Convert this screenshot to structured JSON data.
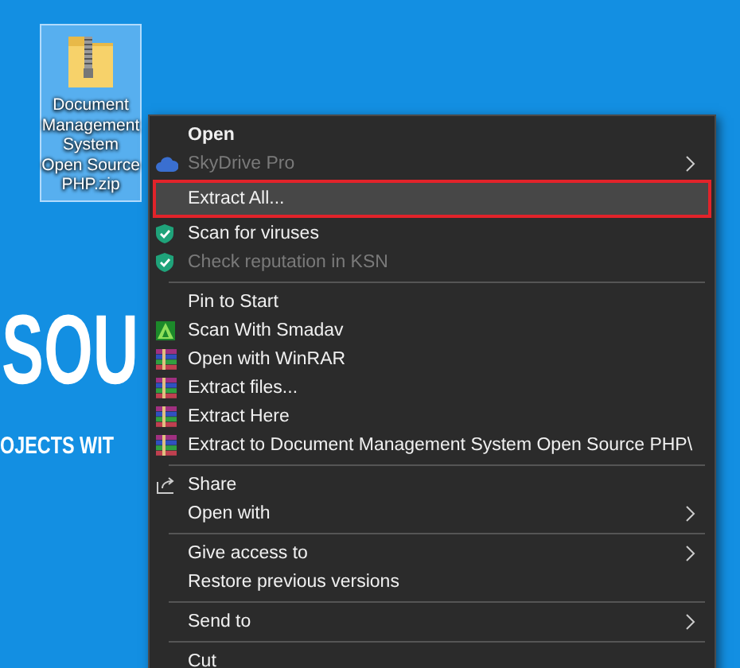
{
  "desktop": {
    "background_text": [
      "SOU",
      "OJECTS WIT"
    ],
    "file_icon": {
      "label": "Document Management System Open Source PHP.zip",
      "selected": true
    }
  },
  "context_menu": {
    "groups": [
      {
        "items": [
          {
            "label": "Open",
            "kind": "plain",
            "default": true,
            "disabled": false,
            "selected": false,
            "submenu": false
          },
          {
            "label": "SkyDrive Pro",
            "kind": "cloud",
            "default": false,
            "disabled": true,
            "selected": false,
            "submenu": true
          },
          {
            "label": "Extract All...",
            "kind": "plain",
            "default": false,
            "disabled": false,
            "selected": true,
            "submenu": false
          },
          {
            "label": "Scan for viruses",
            "kind": "shield",
            "default": false,
            "disabled": false,
            "selected": false,
            "submenu": false
          },
          {
            "label": "Check reputation in KSN",
            "kind": "shield",
            "default": false,
            "disabled": true,
            "selected": false,
            "submenu": false
          }
        ]
      },
      {
        "items": [
          {
            "label": "Pin to Start",
            "kind": "plain",
            "default": false,
            "disabled": false,
            "selected": false,
            "submenu": false
          },
          {
            "label": "Scan With Smadav",
            "kind": "smadav",
            "default": false,
            "disabled": false,
            "selected": false,
            "submenu": false
          },
          {
            "label": "Open with WinRAR",
            "kind": "winrar",
            "default": false,
            "disabled": false,
            "selected": false,
            "submenu": false
          },
          {
            "label": "Extract files...",
            "kind": "winrar",
            "default": false,
            "disabled": false,
            "selected": false,
            "submenu": false
          },
          {
            "label": "Extract Here",
            "kind": "winrar",
            "default": false,
            "disabled": false,
            "selected": false,
            "submenu": false
          },
          {
            "label": "Extract to Document Management System Open Source PHP\\",
            "kind": "winrar",
            "default": false,
            "disabled": false,
            "selected": false,
            "submenu": false
          }
        ]
      },
      {
        "items": [
          {
            "label": "Share",
            "kind": "share",
            "default": false,
            "disabled": false,
            "selected": false,
            "submenu": false
          },
          {
            "label": "Open with",
            "kind": "plain",
            "default": false,
            "disabled": false,
            "selected": false,
            "submenu": true
          }
        ]
      },
      {
        "items": [
          {
            "label": "Give access to",
            "kind": "plain",
            "default": false,
            "disabled": false,
            "selected": false,
            "submenu": true
          },
          {
            "label": "Restore previous versions",
            "kind": "plain",
            "default": false,
            "disabled": false,
            "selected": false,
            "submenu": false
          }
        ]
      },
      {
        "items": [
          {
            "label": "Send to",
            "kind": "plain",
            "default": false,
            "disabled": false,
            "selected": false,
            "submenu": true
          }
        ]
      },
      {
        "items": [
          {
            "label": "Cut",
            "kind": "plain",
            "default": false,
            "disabled": false,
            "selected": false,
            "submenu": false
          }
        ]
      }
    ]
  }
}
